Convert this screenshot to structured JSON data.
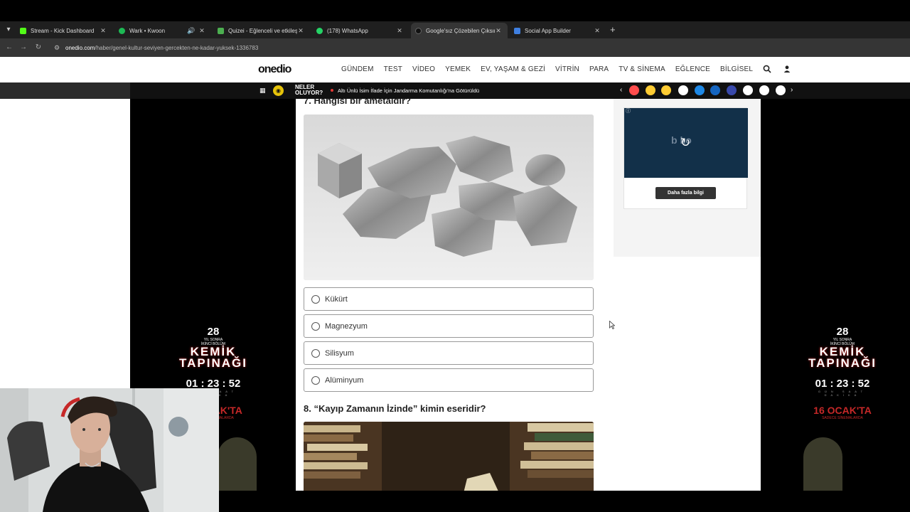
{
  "browser": {
    "tabs": [
      {
        "title": "Stream - Kick Dashboard",
        "favicon_color": "#53fc18",
        "active": false
      },
      {
        "title": "Wark • Kwoon",
        "favicon_color": "#1db954",
        "active": false
      },
      {
        "title": "Quizei - Eğlenceli ve etkileşimli",
        "favicon_color": "#4caf50",
        "active": false
      },
      {
        "title": "(178) WhatsApp",
        "favicon_color": "#25d366",
        "active": false
      },
      {
        "title": "Google'sız Çözebilen Çıksın: Zo",
        "favicon_color": "#222222",
        "active": true
      },
      {
        "title": "Social App Builder",
        "favicon_color": "#3f7fe0",
        "active": false
      }
    ],
    "url_host": "onedio.com",
    "url_path": "/haber/genel-kultur-seviyen-gercekten-ne-kadar-yuksek-1336783"
  },
  "site": {
    "logo": "onedio",
    "nav": [
      "GÜNDEM",
      "TEST",
      "VİDEO",
      "YEMEK",
      "EV, YAŞAM & GEZİ",
      "VİTRİN",
      "PARA",
      "TV & SİNEMA",
      "EĞLENCE",
      "BİLGİSEL"
    ]
  },
  "ticker": {
    "label": "NELER OLUYOR?",
    "headline": "Altı Ünlü İsim İfade İçin Jandarma Komutanlığı'na Götürüldü",
    "emoji_colors": [
      "#ff4d4d",
      "#ffcc33",
      "#ffcc33",
      "#ffffff",
      "#1e88e5",
      "#1565c0",
      "#3949ab",
      "#ffffff",
      "#ffffff",
      "#ffffff"
    ]
  },
  "quiz": {
    "q7": {
      "title": "7. Hangisi bir ametaldir?",
      "options": [
        "Kükürt",
        "Magnezyum",
        "Silisyum",
        "Alüminyum"
      ]
    },
    "q8": {
      "title": "8. “Kayıp Zamanın İzinde” kimin eseridir?"
    }
  },
  "sidebar_ad": {
    "more_button": "Daha fazla bilgi"
  },
  "promo": {
    "years": "28",
    "years_sub": "YIL SONRA",
    "part": "İKİNCİ BÖLÜM",
    "title_line1": "KEMİK",
    "title_line2": "TAPINAĞI",
    "timer": "01 : 23 : 52",
    "timer_units": "GÜN SAAT DAKİKA",
    "date": "16 OCAK'TA",
    "note": "SADECE SİNEMALARDA"
  }
}
